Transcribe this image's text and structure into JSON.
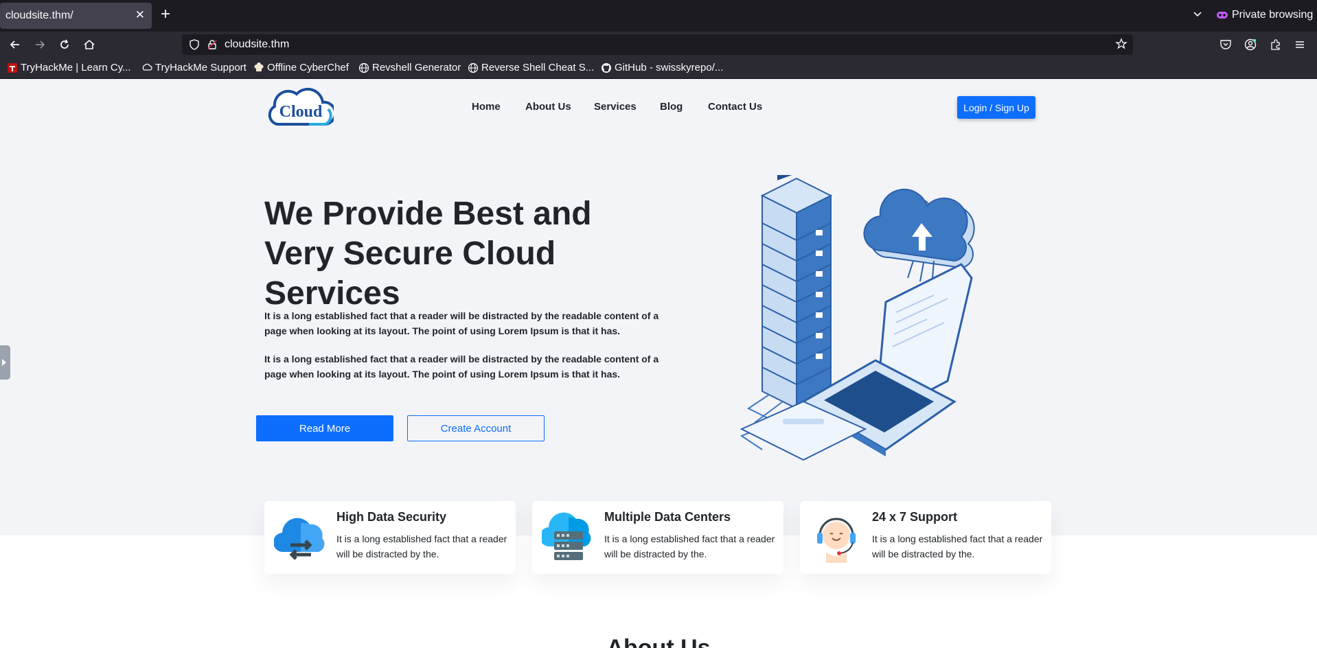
{
  "browser": {
    "tab_title": "cloudsite.thm/",
    "tab_close": "✕",
    "new_tab": "+",
    "private_label": "Private browsing",
    "url": "cloudsite.thm",
    "bookmarks": [
      {
        "label": "TryHackMe | Learn Cy...",
        "icon": "tryhackme-icon"
      },
      {
        "label": "TryHackMe Support",
        "icon": "tryhackme-icon"
      },
      {
        "label": "Offline CyberChef",
        "icon": "chef-icon"
      },
      {
        "label": "Revshell Generator",
        "icon": "globe-icon"
      },
      {
        "label": "Reverse Shell Cheat S...",
        "icon": "globe-icon"
      },
      {
        "label": "GitHub - swisskyrepo/...",
        "icon": "github-icon"
      }
    ]
  },
  "site": {
    "logo_text": "Cloud",
    "nav": [
      "Home",
      "About Us",
      "Services",
      "Blog",
      "Contact Us"
    ],
    "login_label": "Login / Sign Up"
  },
  "hero": {
    "title": "We Provide Best and Very Secure Cloud Services",
    "paragraphs": [
      "It is a long established fact that a reader will be distracted by the readable content of a page when looking at its layout. The point of using Lorem Ipsum is that it has.",
      "It is a long established fact that a reader will be distracted by the readable content of a page when looking at its layout. The point of using Lorem Ipsum is that it has."
    ],
    "read_more": "Read More",
    "create_account": "Create Account"
  },
  "features": [
    {
      "title": "High Data Security",
      "text": "It is a long established fact that a reader will be distracted by the.",
      "icon": "cloud-transfer-icon"
    },
    {
      "title": "Multiple Data Centers",
      "text": "It is a long established fact that a reader will be distracted by the.",
      "icon": "cloud-server-icon"
    },
    {
      "title": "24 x 7 Support",
      "text": "It is a long established fact that a reader will be distracted by the.",
      "icon": "support-agent-icon"
    }
  ],
  "about": {
    "title": "About Us"
  },
  "colors": {
    "accent": "#0d6efd",
    "page_bg": "#f3f4f8",
    "text": "#212529"
  }
}
